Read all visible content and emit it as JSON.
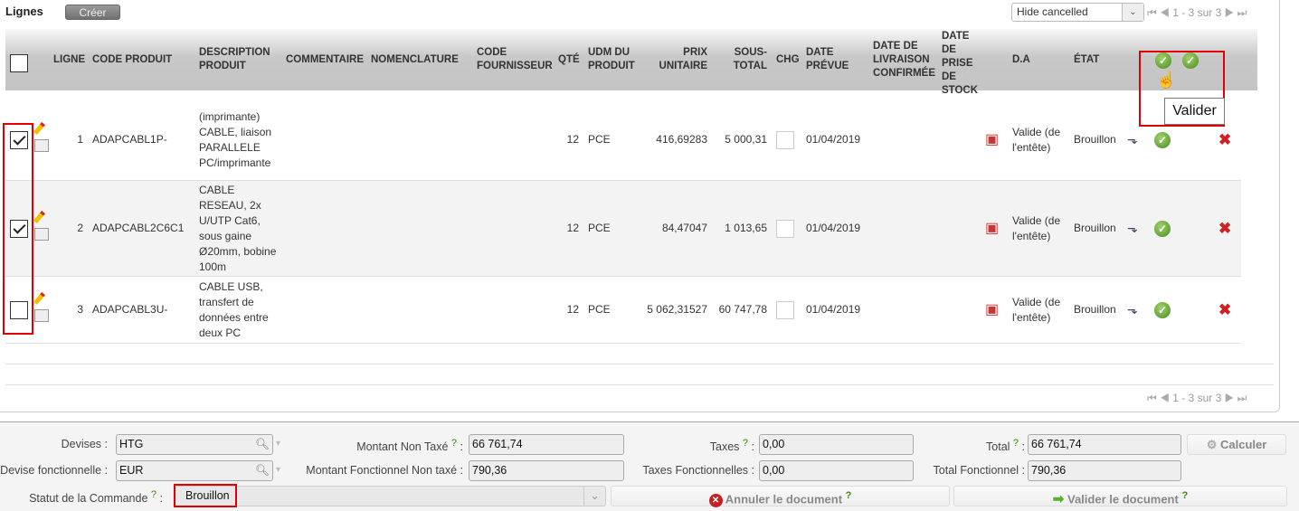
{
  "section": {
    "title": "Lignes",
    "create_label": "Créer",
    "filter_value": "Hide cancelled",
    "pager_text": "1 - 3 sur 3",
    "tooltip": "Valider"
  },
  "columns": {
    "ligne": "LIGNE",
    "code_produit": "CODE PRODUIT",
    "description": "DESCRIPTION PRODUIT",
    "commentaire": "COMMENTAIRE",
    "nomenclature": "NOMENCLATURE",
    "code_fournisseur": "CODE FOURNISSEUR",
    "qte": "QTÉ",
    "udm": "UDM DU PRODUIT",
    "prix": "PRIX UNITAIRE",
    "sous_total": "SOUS-TOTAL",
    "chg": "CHG",
    "date_prevue": "DATE PRÉVUE",
    "date_livraison": "DATE DE LIVRAISON CONFIRMÉE",
    "date_prise": "DATE DE PRISE DE STOCK",
    "da": "D.A",
    "etat": "ÉTAT"
  },
  "rows": [
    {
      "checked": true,
      "ligne": "1",
      "code": "ADAPCABL1P-",
      "description": "(imprimante) CABLE, liaison PARALLELE PC/imprimante",
      "qte": "12",
      "udm": "PCE",
      "prix": "416,69283",
      "sous_total": "5 000,31",
      "date_prevue": "01/04/2019",
      "da": "Valide (de l'entête)",
      "etat": "Brouillon"
    },
    {
      "checked": true,
      "ligne": "2",
      "code": "ADAPCABL2C6C1",
      "description": "CABLE RESEAU, 2x U/UTP Cat6, sous gaine Ø20mm, bobine 100m",
      "qte": "12",
      "udm": "PCE",
      "prix": "84,47047",
      "sous_total": "1 013,65",
      "date_prevue": "01/04/2019",
      "da": "Valide (de l'entête)",
      "etat": "Brouillon"
    },
    {
      "checked": false,
      "ligne": "3",
      "code": "ADAPCABL3U-",
      "description": "CABLE USB, transfert de données entre deux PC",
      "qte": "12",
      "udm": "PCE",
      "prix": "5 062,31527",
      "sous_total": "60 747,78",
      "date_prevue": "01/04/2019",
      "da": "Valide (de l'entête)",
      "etat": "Brouillon"
    }
  ],
  "footer": {
    "devises_label": "Devises :",
    "devises": "HTG",
    "devise_fonc_label": "Devise fonctionnelle :",
    "devise_fonc": "EUR",
    "statut_label": "Statut de la Commande",
    "statut": "Brouillon",
    "mnt_label": "Montant Non Taxé",
    "mnt": "66 761,74",
    "mntf_label": "Montant Fonctionnel Non taxé :",
    "mntf": "790,36",
    "taxes_label": "Taxes",
    "taxes": "0,00",
    "taxesf_label": "Taxes Fonctionnelles :",
    "taxesf": "0,00",
    "total_label": "Total",
    "total": "66 761,74",
    "totalf_label": "Total Fonctionnel :",
    "totalf": "790,36",
    "calc_label": "Calculer",
    "annuler_label": "Annuler le document",
    "valider_label": "Valider le document",
    "help": "?",
    "colon": ":"
  }
}
